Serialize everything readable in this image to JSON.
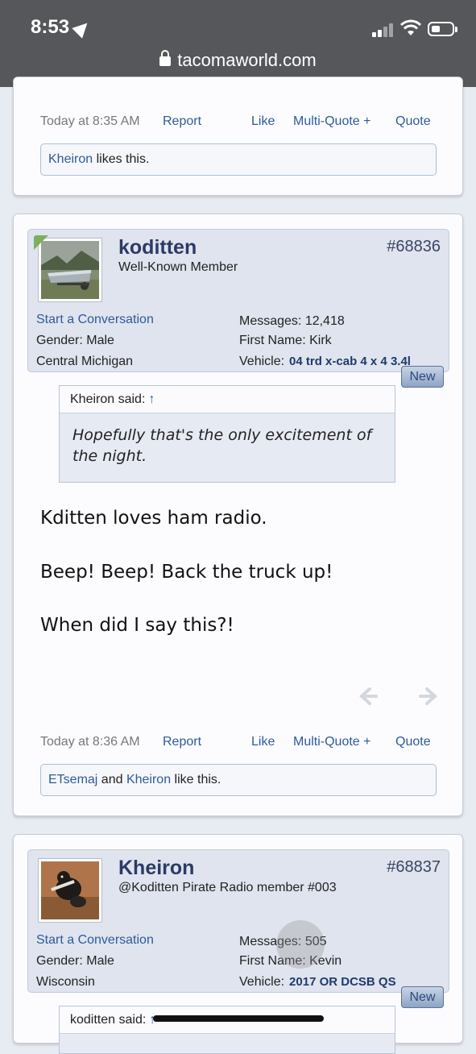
{
  "statusbar": {
    "time": "8:53",
    "url": "tacomaworld.com"
  },
  "post_top": {
    "date": "Today at 8:35 AM",
    "report": "Report",
    "like": "Like",
    "multiquote": "Multi-Quote +",
    "quote": "Quote",
    "likes": {
      "user": "Kheiron",
      "text": " likes this."
    }
  },
  "post_koditten": {
    "username": "koditten",
    "title": "Well-Known Member",
    "post_number": "#68836",
    "start_conversation": "Start a Conversation",
    "gender": "Gender:  Male",
    "location": "Central Michigan",
    "messages": "Messages:  12,418",
    "first_name": "First Name:  Kirk",
    "vehicle_label": "Vehicle:",
    "vehicle_value": "04 trd x-cab 4 x 4 3.4l",
    "new_badge": "New",
    "quote_author": "Kheiron said:",
    "quote_arrow": "↑",
    "quote_text": "Hopefully that's the only excitement of the night.",
    "line1": "Kditten loves ham radio.",
    "line2": "Beep! Beep! Back the truck up!",
    "line3": "When did I say this?!",
    "date": "Today at 8:36 AM",
    "report": "Report",
    "like": "Like",
    "multiquote": "Multi-Quote +",
    "quote": "Quote",
    "likes": {
      "user1": "ETsemaj",
      "and": " and ",
      "user2": "Kheiron",
      "text": " like this."
    }
  },
  "post_kheiron": {
    "username": "Kheiron",
    "title": "@Koditten Pirate Radio member #003",
    "post_number": "#68837",
    "start_conversation": "Start a Conversation",
    "gender": "Gender:  Male",
    "location": "Wisconsin",
    "messages": "Messages:  505",
    "first_name": "First Name:  Kevin",
    "vehicle_label": "Vehicle:",
    "vehicle_value": "2017 OR DCSB QS",
    "new_badge": "New",
    "quote_author": "koditten said:",
    "quote_arrow": "↑"
  },
  "icons": [
    "location-arrow-icon",
    "signal-icon",
    "wifi-icon",
    "battery-icon",
    "lock-icon",
    "prev-arrow-icon",
    "next-arrow-icon"
  ]
}
